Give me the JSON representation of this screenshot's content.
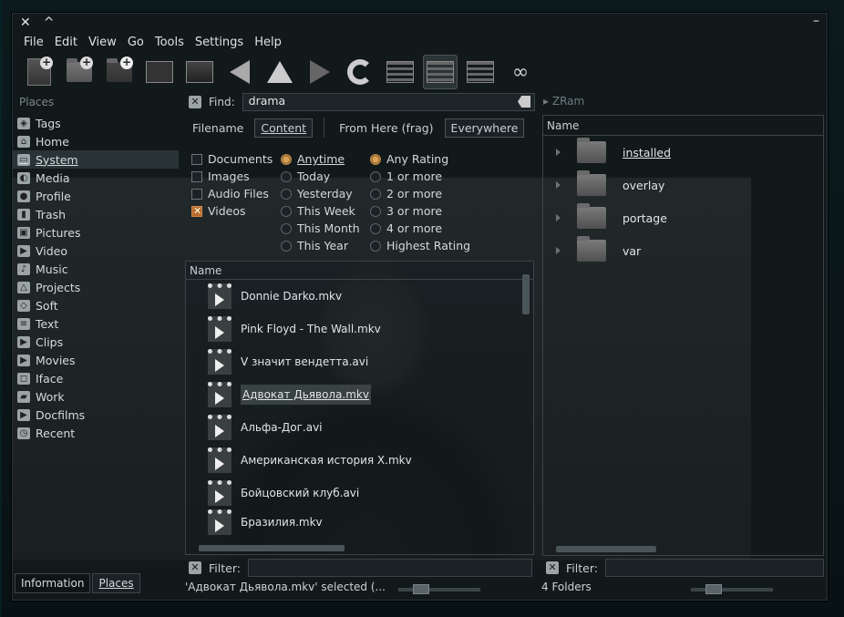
{
  "titlebar": {
    "close": "✕",
    "shade": "^",
    "minimize": "–"
  },
  "menu": [
    "File",
    "Edit",
    "View",
    "Go",
    "Tools",
    "Settings",
    "Help"
  ],
  "places": {
    "heading": "Places",
    "items": [
      "Tags",
      "Home",
      "System",
      "Media",
      "Profile",
      "Trash",
      "Pictures",
      "Video",
      "Music",
      "Projects",
      "Soft",
      "Text",
      "Clips",
      "Movies",
      "Iface",
      "Work",
      "Docfilms",
      "Recent"
    ],
    "selected": "System"
  },
  "bottom_tabs": [
    "Information",
    "Places"
  ],
  "find": {
    "label": "Find:",
    "value": "drama"
  },
  "scope": {
    "filename": "Filename",
    "content": "Content",
    "from_here": "From Here (frag)",
    "everywhere": "Everywhere"
  },
  "types": [
    {
      "label": "Documents",
      "checked": false
    },
    {
      "label": "Images",
      "checked": false
    },
    {
      "label": "Audio Files",
      "checked": false
    },
    {
      "label": "Videos",
      "checked": true
    }
  ],
  "dates": [
    {
      "label": "Anytime",
      "checked": true
    },
    {
      "label": "Today",
      "checked": false
    },
    {
      "label": "Yesterday",
      "checked": false
    },
    {
      "label": "This Week",
      "checked": false
    },
    {
      "label": "This Month",
      "checked": false
    },
    {
      "label": "This Year",
      "checked": false
    }
  ],
  "ratings": [
    {
      "label": "Any Rating",
      "checked": true
    },
    {
      "label": "1 or more",
      "checked": false
    },
    {
      "label": "2 or more",
      "checked": false
    },
    {
      "label": "3 or more",
      "checked": false
    },
    {
      "label": "4 or more",
      "checked": false
    },
    {
      "label": "Highest Rating",
      "checked": false
    }
  ],
  "results": {
    "column": "Name",
    "files": [
      "Donnie Darko.mkv",
      "Pink Floyd - The Wall.mkv",
      "V значит вендетта.avi",
      "Адвокат Дьявола.mkv",
      "Альфа-Дог.avi",
      "Американская история X.mkv",
      "Бойцовский клуб.avi",
      "Бразилия.mkv"
    ],
    "selected_index": 3
  },
  "left_filter": {
    "label": "Filter:",
    "value": ""
  },
  "left_status": "'Адвокат Дьявола.mkv' selected (...",
  "right": {
    "heading": "ZRam",
    "column": "Name",
    "folders": [
      "installed",
      "overlay",
      "portage",
      "var"
    ],
    "filter_label": "Filter:",
    "status": "4 Folders"
  }
}
